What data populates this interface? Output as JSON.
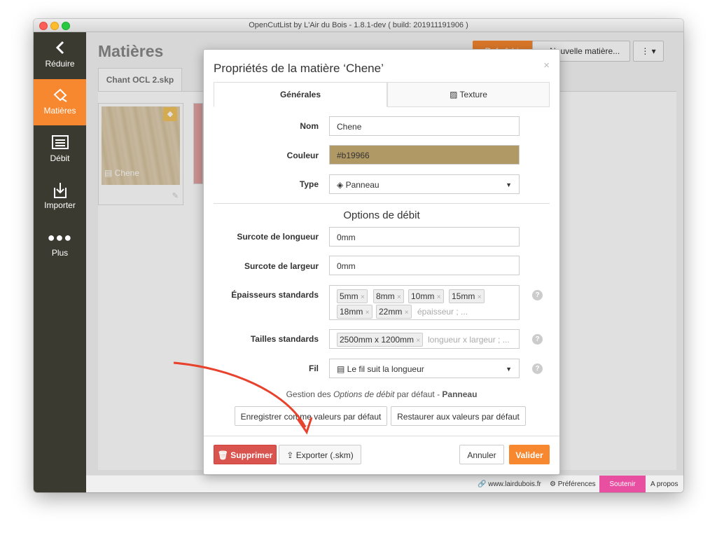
{
  "window": {
    "title": "OpenCutList by L'Air du Bois - 1.8.1-dev ( build: 201911191906 )"
  },
  "sidebar": {
    "items": [
      {
        "label": "Réduire",
        "icon": "chevron-left-icon"
      },
      {
        "label": "Matières",
        "icon": "paint-icon"
      },
      {
        "label": "Débit",
        "icon": "list-icon"
      },
      {
        "label": "Importer",
        "icon": "import-icon"
      },
      {
        "label": "Plus",
        "icon": "more-icon"
      }
    ]
  },
  "main": {
    "title": "Matières",
    "file_tab": "Chant OCL 2.skp",
    "refresh_label": "Rafraîchir",
    "new_material_label": "Nouvelle matière...",
    "material_card": {
      "name": "Chene"
    }
  },
  "modal": {
    "title": "Propriétés de la matière ‘Chene’",
    "close": "×",
    "tabs": {
      "general": "Générales",
      "texture": "Texture"
    },
    "fields": {
      "name_label": "Nom",
      "name_value": "Chene",
      "color_label": "Couleur",
      "color_value": "#b19966",
      "type_label": "Type",
      "type_value": "Panneau"
    },
    "section_title": "Options de débit",
    "options": {
      "length_label": "Surcote de longueur",
      "length_value": "0mm",
      "width_label": "Surcote de largeur",
      "width_value": "0mm",
      "thickness_label": "Épaisseurs standards",
      "thickness_tags": [
        "5mm",
        "8mm",
        "10mm",
        "15mm",
        "18mm",
        "22mm"
      ],
      "thickness_placeholder": "épaisseur ; ...",
      "sizes_label": "Tailles standards",
      "sizes_tags": [
        "2500mm x 1200mm"
      ],
      "sizes_placeholder": "longueur x largeur ; ...",
      "grain_label": "Fil",
      "grain_value": "Le fil suit la longueur"
    },
    "defaults_note": {
      "prefix": "Gestion des ",
      "em": "Options de débit",
      "mid": " par défaut - ",
      "strong": "Panneau"
    },
    "save_defaults": "Enregistrer comme valeurs par défaut",
    "restore_defaults": "Restaurer aux valeurs par défaut",
    "delete": "Supprimer",
    "export": "Exporter (.skm)",
    "cancel": "Annuler",
    "validate": "Valider"
  },
  "statusbar": {
    "website": "www.lairdubois.fr",
    "preferences": "Préférences",
    "support": "Soutenir",
    "about": "A propos"
  },
  "colors": {
    "accent": "#f7882f",
    "sidebar": "#3b3a30",
    "danger": "#d9534f",
    "support": "#e94fa0",
    "material": "#b19966"
  }
}
